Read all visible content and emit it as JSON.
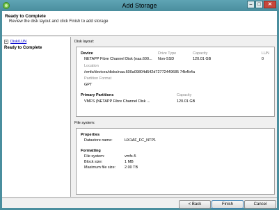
{
  "window": {
    "title": "Add Storage"
  },
  "header": {
    "title": "Ready to Complete",
    "subtitle": "Review the disk layout and click Finish to add storage"
  },
  "nav": {
    "items": [
      {
        "label": "Disk/LUN"
      },
      {
        "label": "Ready to Complete"
      }
    ]
  },
  "disk_layout": {
    "section_label": "Disk layout:",
    "device_header": "Device",
    "drive_type_header": "Drive Type",
    "capacity_header": "Capacity",
    "lun_header": "LUN",
    "device": "NETAPP Fibre Channel Disk (naa.600...",
    "drive_type": "Non-SSD",
    "capacity": "120.01 GB",
    "lun": "0",
    "location_label": "Location",
    "location": "/vmfs/devices/disks/naa.600a09804d542d72772449685 74b4b4a",
    "partition_format_label": "Partition Format",
    "partition_format": "GPT",
    "primary_partitions_header": "Primary Partitions",
    "pp_capacity_header": "Capacity",
    "partition_name": "VMFS (NETAPP Fibre Channel Disk ...",
    "partition_capacity": "120.01 GB"
  },
  "file_system": {
    "section_label": "File system:",
    "properties_header": "Properties",
    "datastore_label": "Datastore name:",
    "datastore_value": "HX1AF_FC_NTP1",
    "formatting_header": "Formatting",
    "fs_label": "File system:",
    "fs_value": "vmfs-5",
    "block_label": "Block size:",
    "block_value": "1 MB",
    "maxfile_label": "Maximum file size:",
    "maxfile_value": "2.00 TB"
  },
  "buttons": {
    "back": "< Back",
    "finish": "Finish",
    "cancel": "Cancel"
  }
}
